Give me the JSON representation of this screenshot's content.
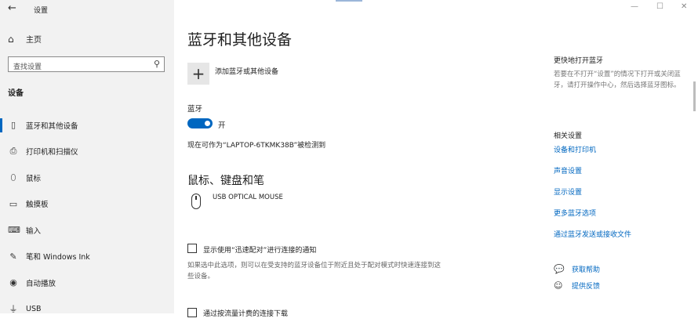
{
  "window": {
    "title": "设置",
    "minimize_glyph": "—",
    "maximize_glyph": "☐",
    "close_glyph": "✕"
  },
  "sidebar": {
    "home_label": "主页",
    "search_placeholder": "查找设置",
    "section_label": "设备",
    "items": [
      {
        "label": "蓝牙和其他设备",
        "icon": "bluetooth-devices-icon",
        "glyph": "▯",
        "active": true
      },
      {
        "label": "打印机和扫描仪",
        "icon": "printer-icon",
        "glyph": "⎙",
        "active": false
      },
      {
        "label": "鼠标",
        "icon": "mouse-icon",
        "glyph": "⬯",
        "active": false
      },
      {
        "label": "触摸板",
        "icon": "touchpad-icon",
        "glyph": "▭",
        "active": false
      },
      {
        "label": "输入",
        "icon": "keyboard-icon",
        "glyph": "⌨",
        "active": false
      },
      {
        "label": "笔和 Windows Ink",
        "icon": "pen-icon",
        "glyph": "✎",
        "active": false
      },
      {
        "label": "自动播放",
        "icon": "autoplay-icon",
        "glyph": "◉",
        "active": false
      },
      {
        "label": "USB",
        "icon": "usb-icon",
        "glyph": "⏚",
        "active": false
      }
    ]
  },
  "main": {
    "title": "蓝牙和其他设备",
    "add_device_label": "添加蓝牙或其他设备",
    "bluetooth_label": "蓝牙",
    "bluetooth_state": "开",
    "bluetooth_on": true,
    "discoverable_text": "现在可作为“LAPTOP-6TKMK38B”被检测到",
    "mouse_section_title": "鼠标、键盘和笔",
    "devices": [
      "USB OPTICAL MOUSE"
    ],
    "swift_pair_label": "显示使用“迅速配对”进行连接的通知",
    "swift_pair_checked": false,
    "swift_pair_desc": "如果选中此选项，则可以在受支持的蓝牙设备位于附近且处于配对模式时快速连接到这些设备。",
    "metered_label": "通过按流量计费的连接下载"
  },
  "right_panel": {
    "quick_title": "更快地打开蓝牙",
    "quick_desc": "若要在不打开“设置”的情况下打开或关闭蓝牙，请打开操作中心，然后选择蓝牙图标。",
    "related_title": "相关设置",
    "links": [
      "设备和打印机",
      "声音设置",
      "显示设置",
      "更多蓝牙选项",
      "通过蓝牙发送或接收文件"
    ],
    "get_help": "获取帮助",
    "feedback": "提供反馈"
  },
  "colors": {
    "accent": "#0067c0",
    "sidebar_bg": "#f2f2f2"
  }
}
